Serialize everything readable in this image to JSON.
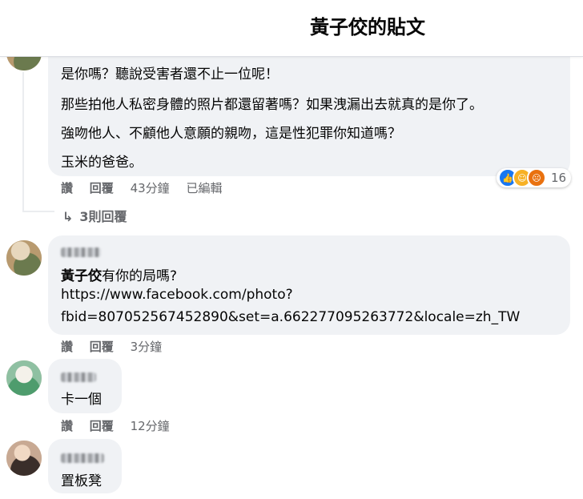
{
  "header": {
    "title": "黃子佼的貼文"
  },
  "comment1": {
    "lines": [
      "是你嗎？聽說受害者還不止一位呢！",
      "那些拍他人私密身體的照片都還留著嗎？如果洩漏出去就真的是你了。",
      "強吻他人、不顧他人意願的親吻，這是性犯罪你知道嗎？",
      "玉米的爸爸。"
    ],
    "actions": {
      "like": "讚",
      "reply": "回覆",
      "time": "43分鐘",
      "edited": "已編輯"
    },
    "reactions": {
      "count": "16",
      "icons": [
        "like-icon",
        "haha-icon",
        "angry-icon"
      ]
    },
    "replies_link": "3則回覆"
  },
  "comment2": {
    "mention": "黃子佼",
    "text": "有你的局嗎?",
    "link_line1": "https://www.facebook.com/photo?",
    "link_line2": "fbid=807052567452890&set=a.662277095263772&locale=zh_TW",
    "actions": {
      "like": "讚",
      "reply": "回覆",
      "time": "3分鐘"
    }
  },
  "comment3": {
    "text": "卡一個",
    "actions": {
      "like": "讚",
      "reply": "回覆",
      "time": "12分鐘"
    }
  },
  "comment4": {
    "text": "置板凳"
  },
  "colors": {
    "bubble": "#f0f2f5",
    "link_blue": "#1877f2",
    "muted": "#65676b"
  }
}
